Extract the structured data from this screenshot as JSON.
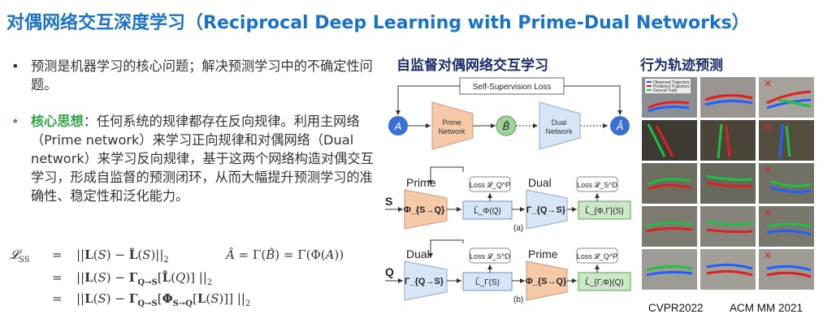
{
  "title": "对偶网络交互深度学习（Reciprocal Deep Learning with Prime-Dual Networks）",
  "bullets": [
    {
      "text": "预测是机器学习的核心问题；解决预测学习中的不确定性问题。"
    },
    {
      "highlight": "核心思想",
      "text": "：任何系统的规律都存在反向规律。利用主网络（Prime network）来学习正向规律和对偶网络（Dual network）来学习反向规律，基于这两个网络构造对偶交互学习，形成自监督的预测闭环，从而大幅提升预测学习的准确性、稳定性和泛化能力。"
    }
  ],
  "equations": {
    "lhs": "𝓛_SS",
    "eq": "=",
    "line1": "||L(S) − L̂(S)||₂",
    "line2": "||L(S) − Γ_{Q→S}[L̂(Q)] ||₂",
    "line3": "||L(S) − Γ_{Q→S}[Φ_{S→Q}[L(S)]] ||₂",
    "right": "Â = Γ(B̂) = Γ(Φ(A))"
  },
  "diagram": {
    "heading": "自监督对偶网络交互学习",
    "loss_label": "Self-Supervision Loss",
    "node_a": "A",
    "prime_label_1": "Prime",
    "prime_label_2": "Network",
    "node_b_hat": "B̂",
    "dual_label_1": "Dual",
    "dual_label_2": "Network",
    "node_a_hat": "Â",
    "colors": {
      "node_blue": "#3b6fd8",
      "prime_fill": "#f6c9a8",
      "dual_fill": "#d7e6f7",
      "b_fill": "#9fd39a"
    }
  },
  "panel_a": {
    "top_left": "Prime",
    "top_mid": "Dual",
    "input": "S",
    "phi": "Φ_{S→Q}",
    "loss1": "Loss 𝓛_Q^P",
    "loss2": "Loss 𝓛_S^D",
    "l_phi": "L̂_Φ(Q)",
    "gamma": "Γ_{Q→S}",
    "l_phigamma": "L̂_{Φ,Γ}(S)",
    "tag": "(a)"
  },
  "panel_b": {
    "top_left": "Dual",
    "top_mid": "Prime",
    "input": "Q",
    "gamma": "Γ_{Q→S}",
    "loss1": "Loss 𝓛_S^D",
    "loss2": "Loss 𝓛_Q^P",
    "l_gamma": "L̂_Γ(S)",
    "phi": "Φ_{S→Q}",
    "l_gammaphi": "L̂_{Γ,Φ}(Q)",
    "tag": "(b)"
  },
  "trajectory": {
    "heading": "行为轨迹预测",
    "legend": [
      "Observed Trajectory",
      "Predicted Trajectory",
      "Ground Truth"
    ],
    "captions": [
      "CVPR2022",
      "ACM MM 2021"
    ]
  }
}
